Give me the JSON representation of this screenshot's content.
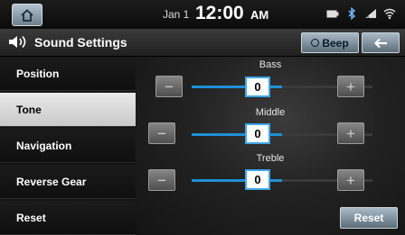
{
  "status_bar": {
    "date": "Jan 1",
    "time": "12:00",
    "ampm": "AM"
  },
  "header": {
    "title": "Sound Settings",
    "beep_label": "Beep"
  },
  "sidebar": {
    "items": [
      {
        "label": "Position",
        "active": false
      },
      {
        "label": "Tone",
        "active": true
      },
      {
        "label": "Navigation",
        "active": false
      },
      {
        "label": "Reverse Gear",
        "active": false
      },
      {
        "label": "Reset",
        "active": false
      }
    ]
  },
  "tone": {
    "controls": [
      {
        "label": "Bass",
        "value": "0",
        "level": 0.5
      },
      {
        "label": "Middle",
        "value": "0",
        "level": 0.5
      },
      {
        "label": "Treble",
        "value": "0",
        "level": 0.5
      }
    ],
    "minus_symbol": "−",
    "plus_symbol": "+",
    "reset_label": "Reset"
  },
  "colors": {
    "accent": "#3fa6e8",
    "slider_fill": "#1f8fd6"
  },
  "icons": {
    "home": "home-icon",
    "sound": "speaker-icon",
    "back": "arrow-left-icon",
    "status": [
      "usb-icon",
      "bluetooth-icon",
      "signal-icon",
      "wifi-icon"
    ]
  }
}
